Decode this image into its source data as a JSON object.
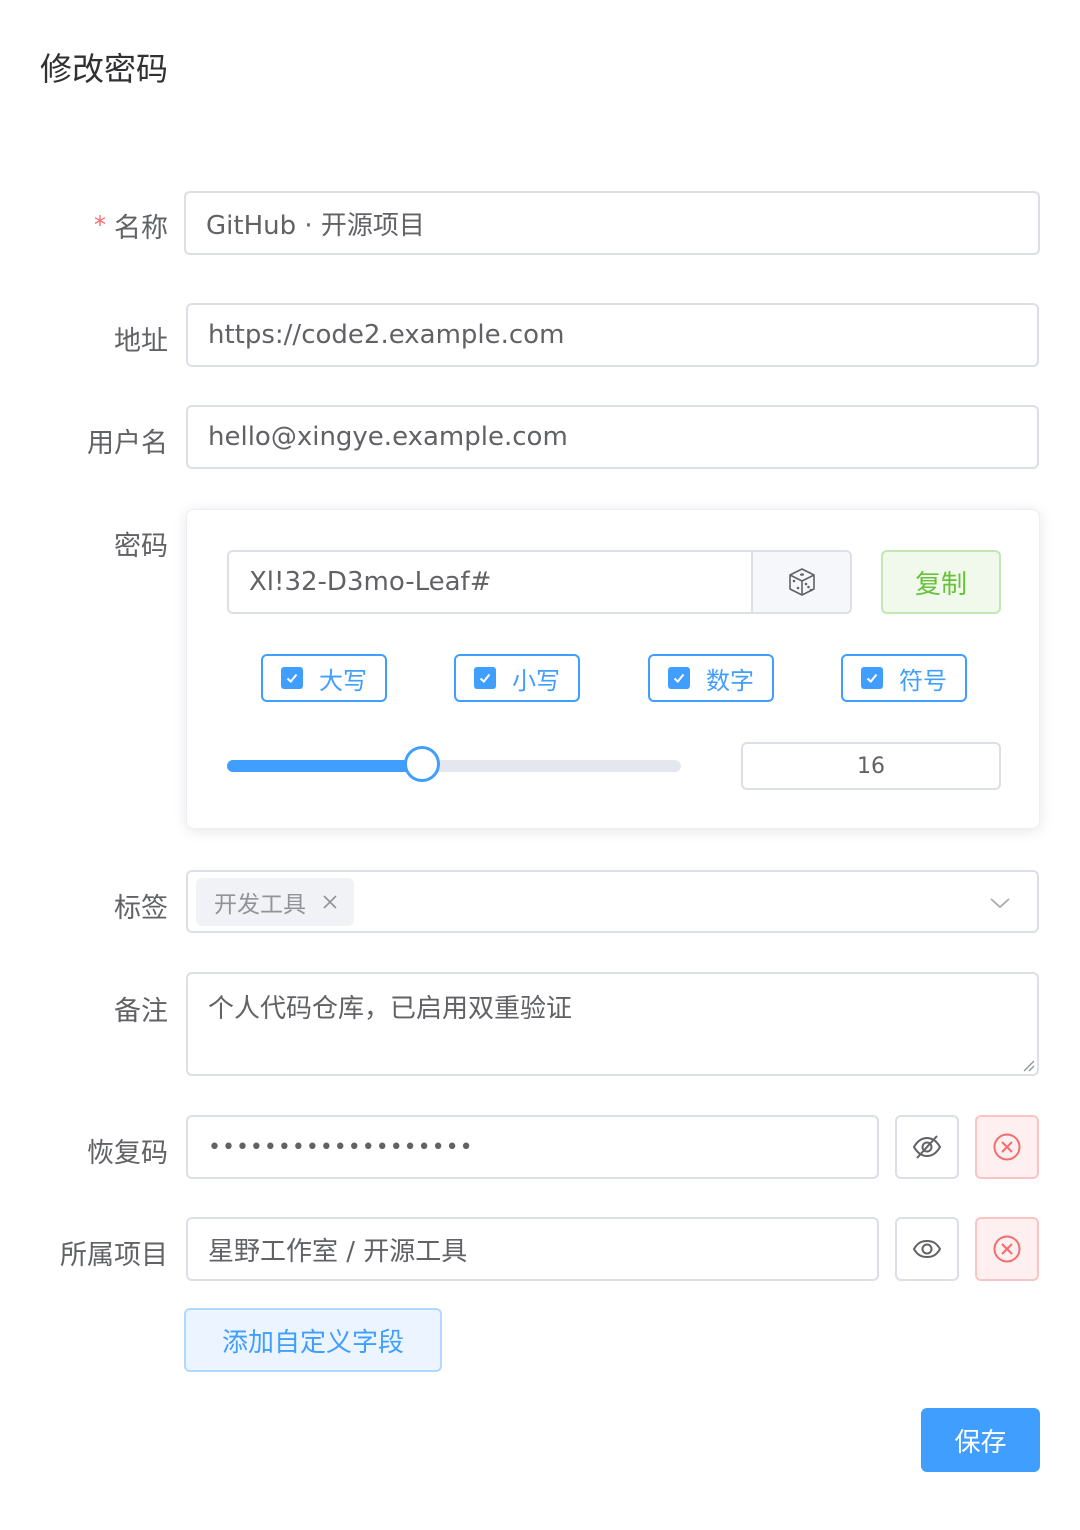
{
  "page": {
    "title": "修改密码"
  },
  "form": {
    "name": {
      "label": "名称",
      "required_mark": "*",
      "value": "GitHub · 开源项目"
    },
    "address": {
      "label": "地址",
      "value": "https://code2.example.com"
    },
    "username": {
      "label": "用户名",
      "value": "hello@xingye.example.com"
    },
    "password": {
      "label": "密码",
      "value": "Xl!32-D3mo-Leaf#",
      "copy_label": "复制",
      "options": [
        {
          "label": "大写",
          "checked": true
        },
        {
          "label": "小写",
          "checked": true
        },
        {
          "label": "数字",
          "checked": true
        },
        {
          "label": "符号",
          "checked": true
        }
      ],
      "length": "16",
      "length_fraction": 0.43
    },
    "tags": {
      "label": "标签",
      "items": [
        "开发工具"
      ]
    },
    "note": {
      "label": "备注",
      "value": "个人代码仓库，已启用双重验证"
    },
    "custom_fields": [
      {
        "label": "恢复码",
        "value": "•••••••••••••••••••",
        "visibility": "hidden"
      },
      {
        "label": "所属项目",
        "value": "星野工作室 / 开源工具",
        "visibility": "visible"
      }
    ],
    "add_field_label": "添加自定义字段",
    "save_label": "保存"
  },
  "colors": {
    "primary": "#409eff",
    "success": "#67c23a",
    "danger": "#f56c6c",
    "text": "#606266"
  },
  "icons": [
    "dice-icon",
    "check-icon",
    "close-icon",
    "chevron-down-icon",
    "eye-off-icon",
    "eye-icon",
    "circle-x-icon"
  ]
}
